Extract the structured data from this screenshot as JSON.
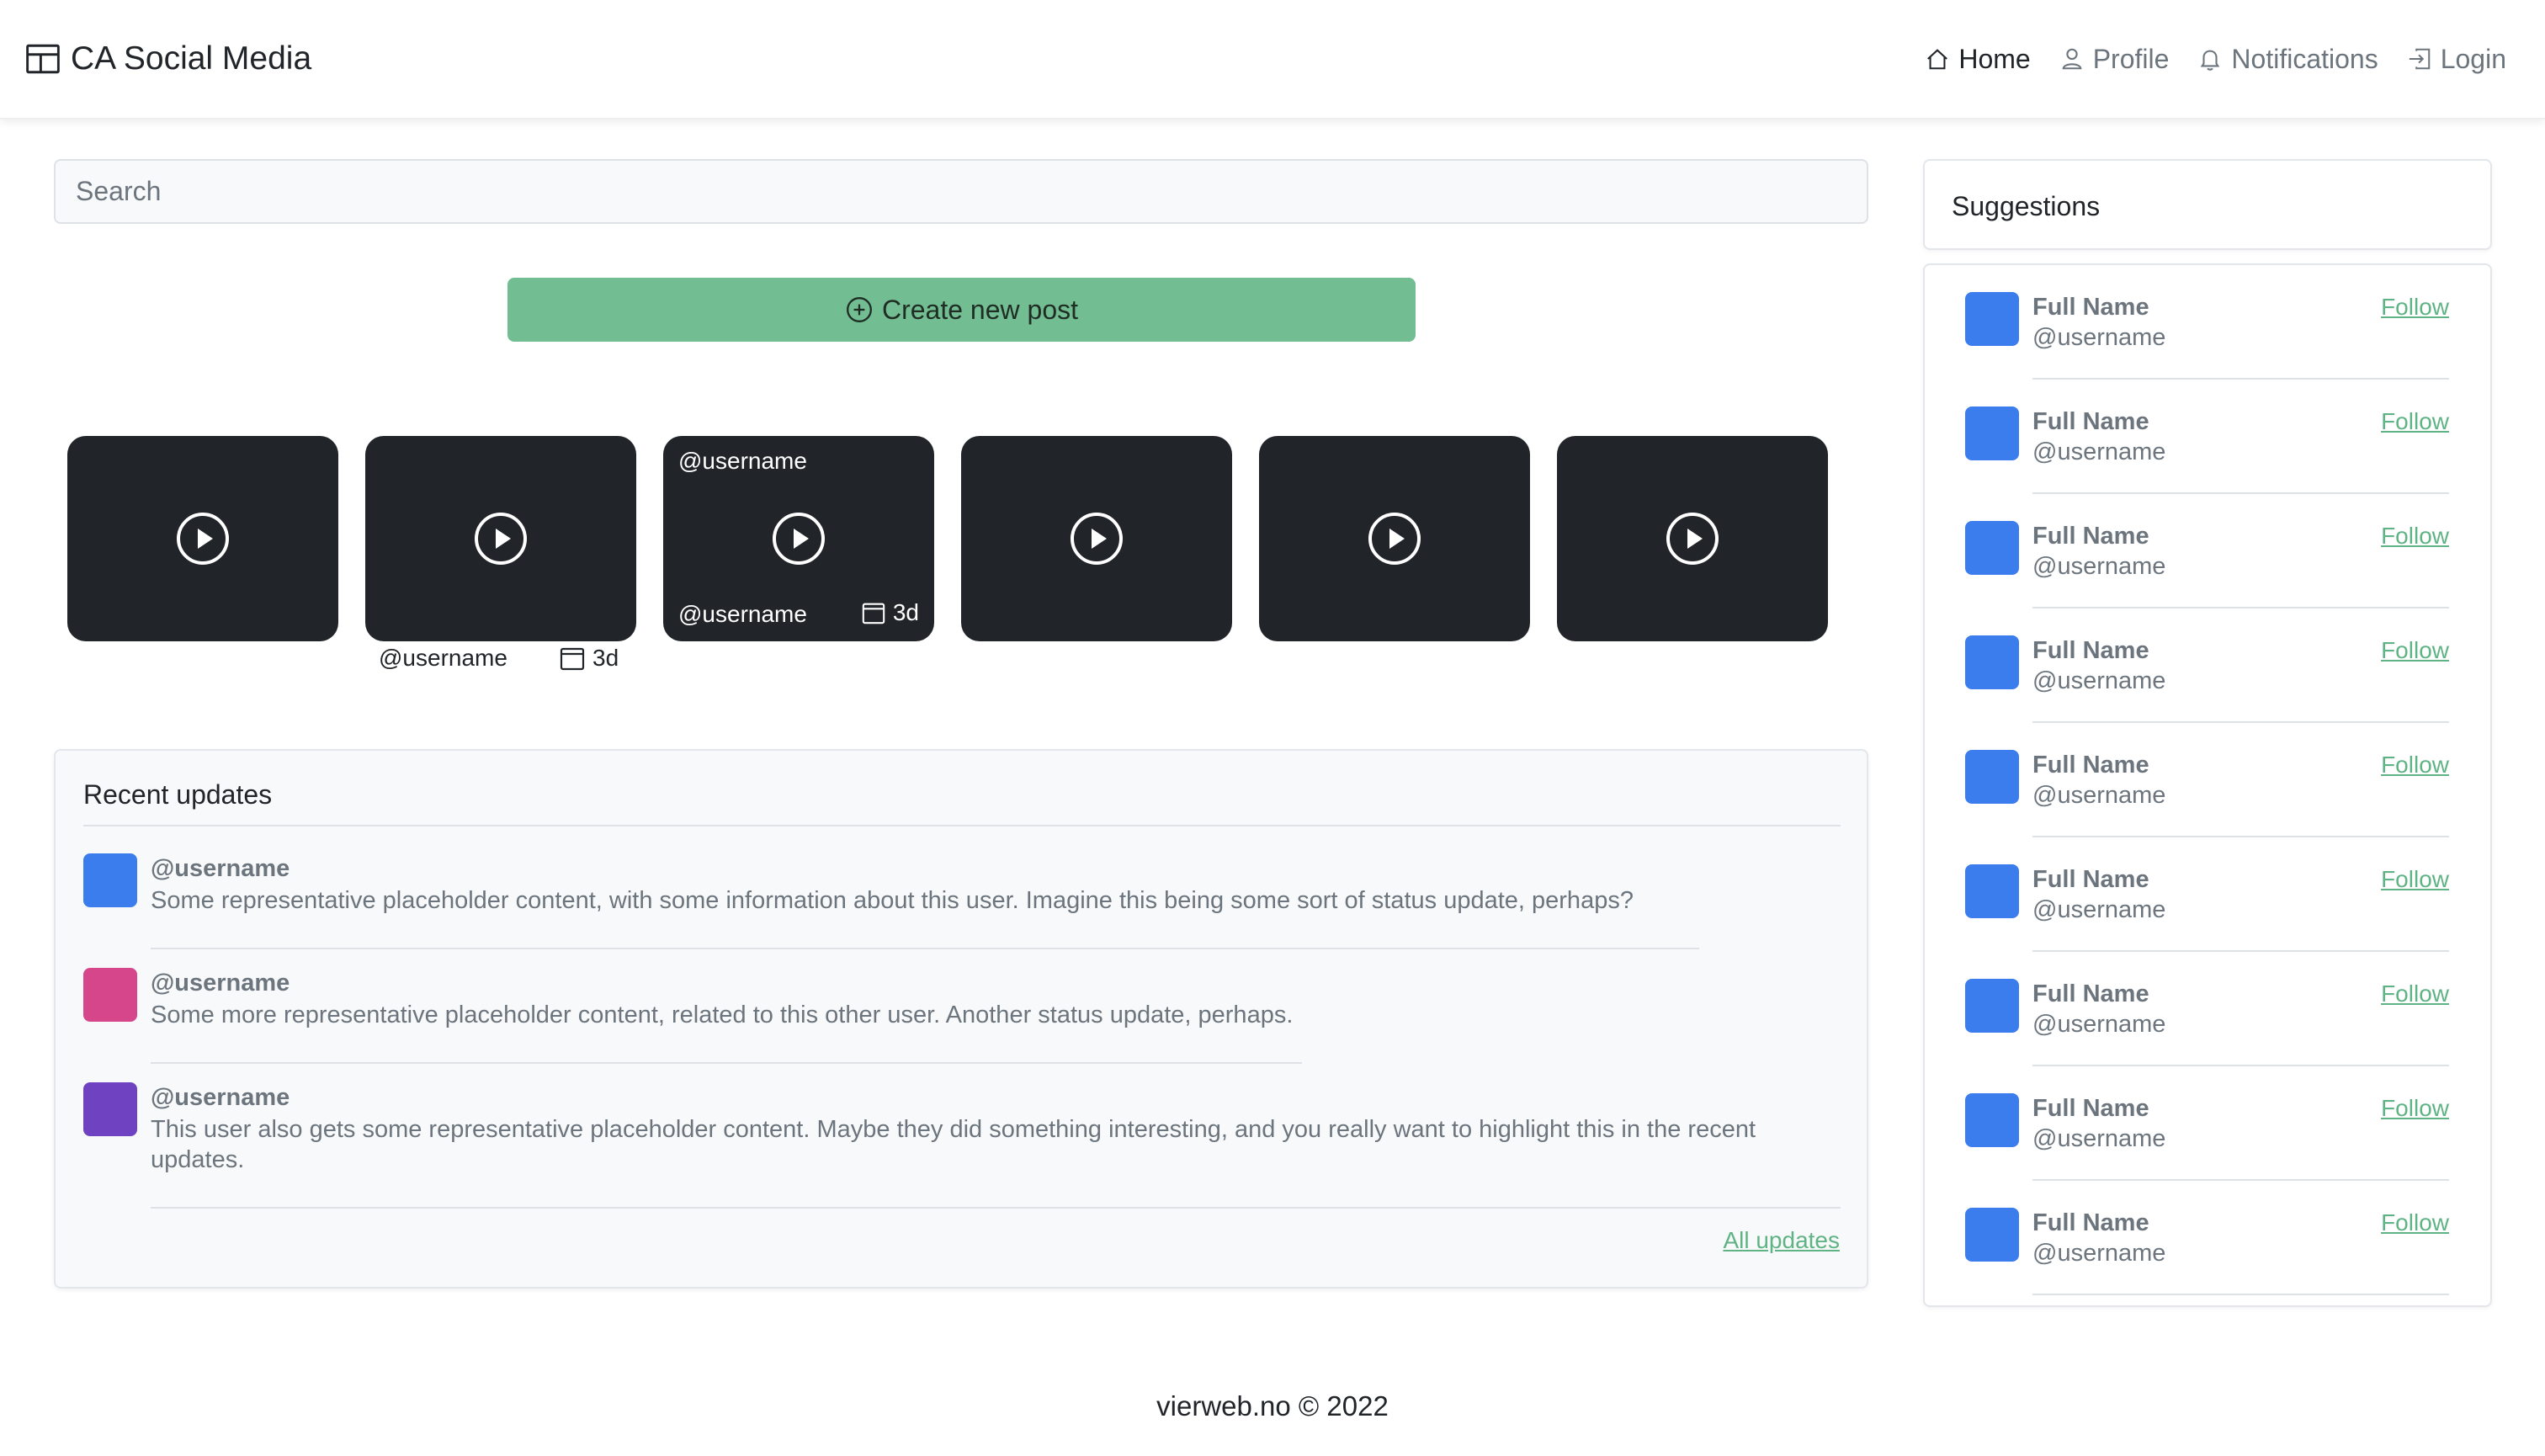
{
  "header": {
    "brand": "CA Social Media",
    "nav": [
      {
        "label": "Home",
        "icon": "house-icon",
        "active": true
      },
      {
        "label": "Profile",
        "icon": "person-icon",
        "active": false
      },
      {
        "label": "Notifications",
        "icon": "bell-icon",
        "active": false
      },
      {
        "label": "Login",
        "icon": "login-icon",
        "active": false
      }
    ]
  },
  "search": {
    "placeholder": "Search"
  },
  "create_post": {
    "label": "Create new post"
  },
  "stories": [
    {
      "icon": "play-icon"
    },
    {
      "icon": "play-icon",
      "below_username": "@username",
      "below_date": "3d"
    },
    {
      "icon": "play-icon",
      "top_username": "@username",
      "bottom_username": "@username",
      "bottom_date": "3d"
    },
    {
      "icon": "play-icon"
    },
    {
      "icon": "play-icon"
    },
    {
      "icon": "play-icon"
    }
  ],
  "recent_updates": {
    "title": "Recent updates",
    "items": [
      {
        "username": "@username",
        "text": "Some representative placeholder content, with some information about this user. Imagine this being some sort of status update, perhaps?",
        "color": "#3b7ded"
      },
      {
        "username": "@username",
        "text": "Some more representative placeholder content, related to this other user. Another status update, perhaps.",
        "color": "#d6468b"
      },
      {
        "username": "@username",
        "text": "This user also gets some representative placeholder content. Maybe they did something interesting, and you really want to highlight this in the recent updates.",
        "color": "#6f42c1"
      }
    ],
    "all_link": "All updates"
  },
  "suggestions": {
    "title": "Suggestions",
    "items": [
      {
        "full_name": "Full Name",
        "username": "@username",
        "follow": "Follow"
      },
      {
        "full_name": "Full Name",
        "username": "@username",
        "follow": "Follow"
      },
      {
        "full_name": "Full Name",
        "username": "@username",
        "follow": "Follow"
      },
      {
        "full_name": "Full Name",
        "username": "@username",
        "follow": "Follow"
      },
      {
        "full_name": "Full Name",
        "username": "@username",
        "follow": "Follow"
      },
      {
        "full_name": "Full Name",
        "username": "@username",
        "follow": "Follow"
      },
      {
        "full_name": "Full Name",
        "username": "@username",
        "follow": "Follow"
      },
      {
        "full_name": "Full Name",
        "username": "@username",
        "follow": "Follow"
      },
      {
        "full_name": "Full Name",
        "username": "@username",
        "follow": "Follow"
      }
    ]
  },
  "footer": {
    "text": "vierweb.no © 2022"
  },
  "colors": {
    "accent": "#72be92",
    "link": "#5fb384",
    "story_bg": "#212529",
    "avatar_blue": "#3b7ded"
  }
}
